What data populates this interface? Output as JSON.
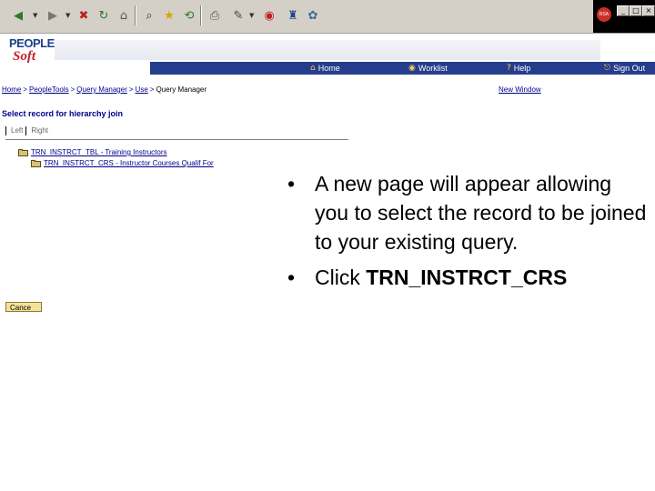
{
  "window": {
    "minimize": "_",
    "maximize": "□",
    "close": "×"
  },
  "toolbar": {
    "icons": [
      "back-icon",
      "forward-icon",
      "stop-icon",
      "refresh-icon",
      "home-icon",
      "search-icon",
      "favorites-icon",
      "history-icon",
      "print-icon",
      "edit-icon",
      "discuss-icon",
      "messenger-icon",
      "related-icon"
    ],
    "brand_logo": "RSA"
  },
  "header": {
    "logo_top": "PEOPLE",
    "logo_bottom": "Soft",
    "nav": {
      "home": "Home",
      "worklist": "Worklist",
      "help": "Help",
      "signout": "Sign Out"
    }
  },
  "breadcrumb": {
    "items": [
      "Home",
      "PeopleTools",
      "Query Manager",
      "Use"
    ],
    "separator": ">",
    "current": "Query Manager"
  },
  "new_window": "New Window",
  "page_title": "Select record for hierarchy join",
  "tabs": {
    "left": "Left",
    "right": "Right"
  },
  "tree": {
    "record1": "TRN_INSTRCT_TBL - Training Instructors",
    "record2": "TRN_INSTRCT_CRS - Instructor Courses Qualif For"
  },
  "cancel_label": "Cance",
  "slide": {
    "bullet_char": "•",
    "bullet1": "A new page will appear allowing you to select the record to be joined to your existing query.",
    "bullet2_prefix": "Click ",
    "bullet2_bold": "TRN_INSTRCT_CRS"
  },
  "colors": {
    "nav_band": "#243d8c",
    "link": "#00008b",
    "logo_blue": "#1c3f8a",
    "logo_red": "#c0202a",
    "cancel_button": "#f3e39a"
  }
}
